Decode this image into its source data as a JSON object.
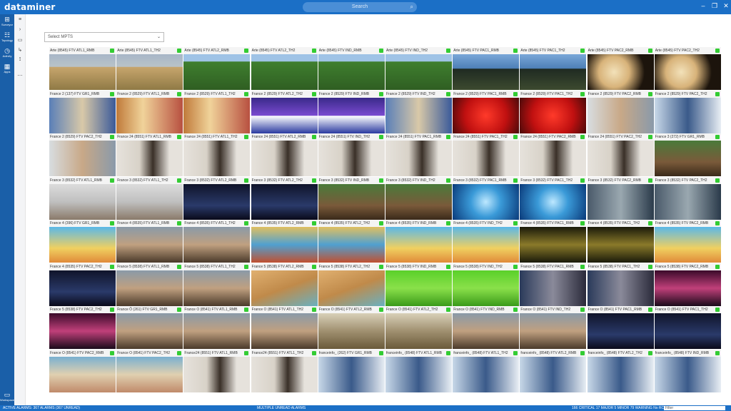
{
  "app": {
    "logo": "dataminer"
  },
  "search": {
    "placeholder": "Search"
  },
  "sidebar": {
    "items": [
      {
        "label": "Surveyor",
        "icon": "surveyor-icon"
      },
      {
        "label": "Topology",
        "icon": "topology-icon"
      },
      {
        "label": "Activity",
        "icon": "activity-icon"
      },
      {
        "label": "Apps",
        "icon": "apps-icon"
      }
    ],
    "bottom": {
      "label": "Workspace",
      "icon": "workspace-icon"
    }
  },
  "select": {
    "value": "Select MPTS"
  },
  "grid": {
    "rows": [
      [
        "Arte (8545) FTV ATL1_RMB",
        "Arte (8545) FTV ATL1_TH2",
        "Arte (8545) FTV ATL2_RMB",
        "Arte (8545) FTV ATL2_TH2",
        "Arte (8545) FTV IND_RMB",
        "Arte (8545) FTV IND_TH2",
        "Arte (8545) FTV PAC1_RMB",
        "Arte (8545) FTV PAC1_TH2",
        "Arte (8545) FTV PAC2_RMB",
        "Arte (8545) FTV PAC2_TH2"
      ],
      [
        "France 2 (137) FTV GR1_RMB",
        "France 2 (8529) FTV ATL1_RMB",
        "France 2 (8529) FTV ATL1_TH2",
        "France 2 (8529) FTV ATL2_TH2",
        "France 2 (8529) FTV IND_RMB",
        "France 2 (8529) FTV IND_TH2",
        "France 2 (8529) FTV PAC1_RMB",
        "France 2 (8529) FTV PAC1_TH2",
        "France 2 (8529) FTV PAC2_RMB",
        "France 2 (8529) FTV PAC2_TH2"
      ],
      [
        "France 2 (8529) FTV PAC2_TH2",
        "France 24 (8551) FTV ATL1_RMB",
        "France 24 (8551) FTV ATL1_TH2",
        "France 24 (8551) FTV ATL2_RMB",
        "France 24 (8551) FTV IND_TH2",
        "France 24 (8551) FTV PAC1_RMB",
        "France 24 (8551) FTV PAC1_TH2",
        "France 24 (8551) FTV PAC2_RMB",
        "France 24 (8551) FTV PAC2_TH2",
        "France 3 (272) FTV GR1_RMB"
      ],
      [
        "France 3 (8532) FTV ATL1_RMB",
        "France 3 (8532) FTV ATL1_TH2",
        "France 3 (8532) FTV ATL2_RMB",
        "France 3 (8532) FTV ATL2_TH2",
        "France 3 (8532) FTV IND_RMB",
        "France 3 (8532) FTV IND_TH2",
        "France 3 (8532) FTV PAC1_RMB",
        "France 3 (8532) FTV PAC1_TH2",
        "France 3 (8532) FTV PAC2_RMB",
        "France 3 (8532) FTV PAC2_TH2"
      ],
      [
        "France 4 (396) FTV GR1_RMB",
        "France 4 (8535) FTV ATL1_RMB",
        "France 4 (8535) FTV ATL1_TH2",
        "France 4 (8535) FTV ATL2_RMB",
        "France 4 (8535) FTV ATL2_TH2",
        "France 4 (8535) FTV IND_RMB",
        "France 4 (8535) FTV IND_TH2",
        "France 4 (8535) FTV PAC1_RMB",
        "France 4 (8535) FTV PAC1_TH2",
        "France 4 (8535) FTV PAC2_RMB"
      ],
      [
        "France 4 (8535) FTV PAC2_TH2",
        "France 5 (8538) FTV ATL1_RMB",
        "France 5 (8538) FTV ATL1_TH2",
        "France 5 (8538) FTV ATL2_RMB",
        "France 5 (8538) FTV ATL2_TH2",
        "France 5 (8538) FTV IND_RMB",
        "France 5 (8538) FTV IND_TH2",
        "France 5 (8538) FTV PAC1_RMB",
        "France 5 (8538) FTV PAC1_TH2",
        "France 5 (8538) FTV PAC2_RMB"
      ],
      [
        "France 5 (8538) FTV PAC2_TH2",
        "France Ô (261) FTV GR1_RMB",
        "France O (8541) FTV ATL1_RMB",
        "France O (8541) FTV ATL1_TH2",
        "France O (8541) FTV ATL2_RMB",
        "France O (8541) FTV ATL2_TH2",
        "France O (8541) FTV IND_RMB",
        "France O (8541) FTV IND_TH2",
        "France O (8541) FTV PAC1_RMB",
        "France O (8541) FTV PAC1_TH2"
      ],
      [
        "France O (8541) FTV PAC2_RMB",
        "France O (8541) FTV PAC2_TH2",
        "France24 (8551) FTV ATL1_RMB",
        "France24 (8551) FTV ATL1_TH2",
        "franceinfo_ (262) FTV GR1_RMB",
        "franceinfo_ (8548) FTV ATL1_RMB",
        "franceinfo_ (8548) FTV ATL1_TH2",
        "franceinfo_ (8548) FTV ATL2_RMB",
        "franceinfo_ (8548) FTV ATL2_TH2",
        "franceinfo_ (8548) FTV IND_RMB"
      ]
    ],
    "themes": [
      [
        "desert",
        "desert",
        "forest",
        "forest",
        "forest",
        "forest",
        "canyon",
        "canyon",
        "shell",
        "shell"
      ],
      [
        "studio",
        "studio2",
        "studio2",
        "stage",
        "stage",
        "studio",
        "berries",
        "berries",
        "portrait"
      ],
      [
        "portrait",
        "disco",
        "disco",
        "disco",
        "disco",
        "disco",
        "disco",
        "disco",
        "disco",
        "cartoon"
      ],
      [
        "white",
        "white",
        "dark",
        "dark",
        "cartoon",
        "cartoon",
        "bluebubble",
        "bluebubble",
        "lab",
        "lab"
      ],
      [
        "cartoon2",
        "cook",
        "cook",
        "pirate",
        "pirate",
        "cartoon2",
        "cartoon2",
        "gold",
        "gold",
        "cartoon2"
      ],
      [
        "dark",
        "cook",
        "cook",
        "sand",
        "sand",
        "green",
        "green",
        "interview",
        "interview",
        "show"
      ],
      [
        "show",
        "cook",
        "cook",
        "cook",
        "hands",
        "hands",
        "cook",
        "cook",
        "dark",
        "dark"
      ],
      [
        "beach",
        "beach",
        "disco",
        "disco",
        "news",
        "news",
        "news",
        "news",
        "news",
        "news"
      ]
    ]
  },
  "status": {
    "left": "ACTIVE ALARMS: 367 ALARMS (367 UNREAD)",
    "mid": "MULTIPLE UNREAD ALARMS",
    "right": "166 CRITICAL   17 MAJOR   5 MINOR   79 WARNING   No RCA filter",
    "filter": "Filter"
  },
  "colors": {
    "accent": "#1b6fc6",
    "ok": "#33cc33"
  }
}
